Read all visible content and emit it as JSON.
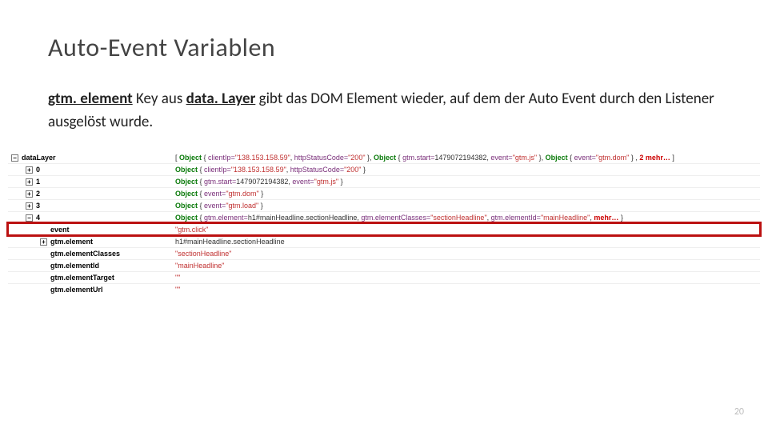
{
  "title": "Auto-Event Variablen",
  "body": {
    "b1": "gtm. element",
    "t1": " Key aus ",
    "b2": "data. Layer",
    "t2": " gibt das DOM Element wieder, auf dem der Auto Event durch den Listener ausgelöst wurde."
  },
  "data_layer": {
    "label": "dataLayer",
    "summary_tokens": [
      {
        "c": "plain",
        "t": "[  "
      },
      {
        "c": "kw",
        "t": "Object"
      },
      {
        "c": "plain",
        "t": " { "
      },
      {
        "c": "ident",
        "t": "clientIp="
      },
      {
        "c": "str",
        "t": "\"138.153.158.59\""
      },
      {
        "c": "plain",
        "t": ", "
      },
      {
        "c": "ident",
        "t": "httpStatusCode="
      },
      {
        "c": "str",
        "t": "\"200\""
      },
      {
        "c": "plain",
        "t": " },  "
      },
      {
        "c": "kw",
        "t": "Object"
      },
      {
        "c": "plain",
        "t": " { "
      },
      {
        "c": "ident",
        "t": "gtm.start="
      },
      {
        "c": "plain",
        "t": "1479072194382, "
      },
      {
        "c": "ident",
        "t": "event="
      },
      {
        "c": "str",
        "t": "\"gtm.js\""
      },
      {
        "c": "plain",
        "t": " },  "
      },
      {
        "c": "kw",
        "t": "Object"
      },
      {
        "c": "plain",
        "t": " { "
      },
      {
        "c": "ident",
        "t": "event="
      },
      {
        "c": "str",
        "t": "\"gtm.dom\""
      },
      {
        "c": "plain",
        "t": " } , "
      },
      {
        "c": "more",
        "t": "2 mehr… "
      },
      {
        "c": "plain",
        "t": "]"
      }
    ],
    "indices": [
      {
        "idx": "0",
        "tokens": [
          {
            "c": "kw",
            "t": "Object"
          },
          {
            "c": "plain",
            "t": " { "
          },
          {
            "c": "ident",
            "t": "clientIp="
          },
          {
            "c": "str",
            "t": "\"138.153.158.59\""
          },
          {
            "c": "plain",
            "t": ", "
          },
          {
            "c": "ident",
            "t": "httpStatusCode="
          },
          {
            "c": "str",
            "t": "\"200\""
          },
          {
            "c": "plain",
            "t": " }"
          }
        ]
      },
      {
        "idx": "1",
        "tokens": [
          {
            "c": "kw",
            "t": "Object"
          },
          {
            "c": "plain",
            "t": " { "
          },
          {
            "c": "ident",
            "t": "gtm.start="
          },
          {
            "c": "plain",
            "t": "1479072194382, "
          },
          {
            "c": "ident",
            "t": "event="
          },
          {
            "c": "str",
            "t": "\"gtm.js\""
          },
          {
            "c": "plain",
            "t": " }"
          }
        ]
      },
      {
        "idx": "2",
        "tokens": [
          {
            "c": "kw",
            "t": "Object"
          },
          {
            "c": "plain",
            "t": " { "
          },
          {
            "c": "ident",
            "t": "event="
          },
          {
            "c": "str",
            "t": "\"gtm.dom\""
          },
          {
            "c": "plain",
            "t": " }"
          }
        ]
      },
      {
        "idx": "3",
        "tokens": [
          {
            "c": "kw",
            "t": "Object"
          },
          {
            "c": "plain",
            "t": " { "
          },
          {
            "c": "ident",
            "t": "event="
          },
          {
            "c": "str",
            "t": "\"gtm.load\""
          },
          {
            "c": "plain",
            "t": " }"
          }
        ]
      },
      {
        "idx": "4",
        "tokens": [
          {
            "c": "kw",
            "t": "Object"
          },
          {
            "c": "plain",
            "t": " { "
          },
          {
            "c": "ident",
            "t": "gtm.element="
          },
          {
            "c": "plain",
            "t": "h1#mainHeadline.sectionHeadline, "
          },
          {
            "c": "ident",
            "t": "gtm.elementClasses="
          },
          {
            "c": "str",
            "t": "\"sectionHeadline\""
          },
          {
            "c": "plain",
            "t": ", "
          },
          {
            "c": "ident",
            "t": "gtm.elementId="
          },
          {
            "c": "str",
            "t": "\"mainHeadline\""
          },
          {
            "c": "plain",
            "t": ",  "
          },
          {
            "c": "more",
            "t": "mehr… "
          },
          {
            "c": "plain",
            "t": "}"
          }
        ]
      }
    ],
    "expanded": [
      {
        "key": "event",
        "tokens": [
          {
            "c": "str",
            "t": "\"gtm.click\""
          }
        ]
      },
      {
        "key": "gtm.element",
        "tokens": [
          {
            "c": "plain",
            "t": "h1#mainHeadline.sectionHeadline"
          }
        ],
        "expandable": true
      },
      {
        "key": "gtm.elementClasses",
        "tokens": [
          {
            "c": "str",
            "t": "\"sectionHeadline\""
          }
        ]
      },
      {
        "key": "gtm.elementId",
        "tokens": [
          {
            "c": "str",
            "t": "\"mainHeadline\""
          }
        ]
      },
      {
        "key": "gtm.elementTarget",
        "tokens": [
          {
            "c": "str",
            "t": "\"\""
          }
        ]
      },
      {
        "key": "gtm.elementUrl",
        "tokens": [
          {
            "c": "str",
            "t": "\"\""
          }
        ]
      }
    ]
  },
  "page_number": "20",
  "glyphs": {
    "plus": "+",
    "minus": "−"
  }
}
